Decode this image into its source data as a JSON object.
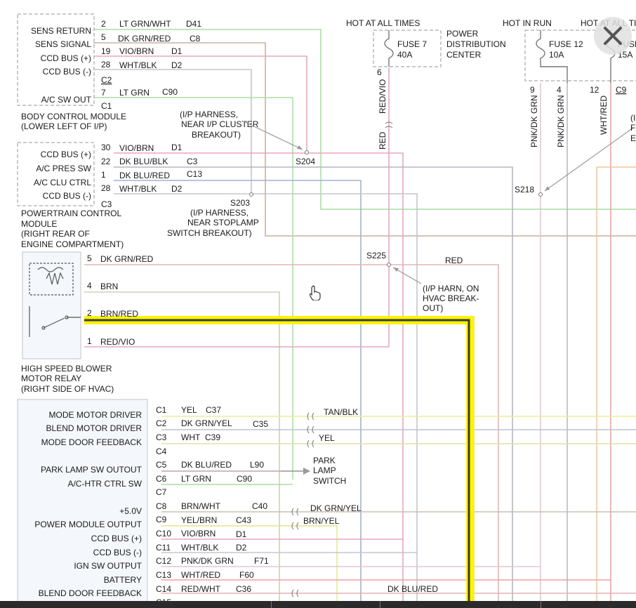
{
  "colors": {
    "highlight": "#fcf400",
    "pink": "#e8a5c4",
    "green": "#a6e0a2",
    "tan": "#c9b29e",
    "gray": "#b5b5c5",
    "blue": "#a3afd8",
    "pinkred": "#f0a0a0",
    "yellow": "#e3e48c"
  },
  "ui": {
    "close_icon": "close-icon",
    "cursor_icon": "hand-pointer-icon"
  },
  "bcm": {
    "pins": [
      {
        "label": "SENS RETURN",
        "num": "2",
        "wire": "LT GRN/WHT",
        "circuit": "D41"
      },
      {
        "label": "SENS SIGNAL",
        "num": "5",
        "wire": "DK GRN/RED",
        "circuit": "C8"
      },
      {
        "label": "CCD BUS (+)",
        "num": "19",
        "wire": "VIO/BRN",
        "circuit": "D1"
      },
      {
        "label": "CCD BUS (-)",
        "num": "28",
        "wire": "WHT/BLK",
        "circuit": "D2"
      },
      {
        "label": "A/C SW OUT",
        "num": "7",
        "wire": "LT GRN",
        "circuit": "C90"
      }
    ],
    "connector1": "C2",
    "connector2": "C1",
    "name1": "BODY CONTROL MODULE",
    "name2": "(LOWER LEFT OF I/P)"
  },
  "pcm": {
    "pins": [
      {
        "label": "CCD BUS (+)",
        "num": "30",
        "wire": "VIO/BRN",
        "circuit": "D1"
      },
      {
        "label": "A/C PRES SW",
        "num": "22",
        "wire": "DK BLU/BLK",
        "circuit": "C3"
      },
      {
        "label": "A/C CLU CTRL",
        "num": "1",
        "wire": "DK BLU/RED",
        "circuit": "C13"
      },
      {
        "label": "CCD BUS (-)",
        "num": "28",
        "wire": "WHT/BLK",
        "circuit": "D2"
      }
    ],
    "connector": "C3",
    "name1": "POWERTRAIN CONTROL",
    "name2": "MODULE",
    "name3": "(RIGHT REAR OF",
    "name4": "ENGINE COMPARTMENT)"
  },
  "splices": {
    "s204": "S204",
    "s204_note1": "(I/P HARNESS,",
    "s204_note2": "NEAR I/P CLUSTER",
    "s204_note3": "BREAKOUT)",
    "s203": "S203",
    "s203_note1": "(I/P HARNESS,",
    "s203_note2": "NEAR STOPLAMP",
    "s203_note3": "SWITCH BREAKOUT)",
    "s225": "S225",
    "s225_note1": "(I/P HARN, ON",
    "s225_note2": "HVAC BREAK-",
    "s225_note3": "OUT)",
    "s218": "S218"
  },
  "fuses": {
    "hot_all_times_1": "HOT AT ALL TIMES",
    "hot_in_run": "HOT IN RUN",
    "hot_all_times_2": "HOT AT ALL TI",
    "fuse7": "FUSE 7",
    "fuse7_amp": "40A",
    "pdc1": "POWER",
    "pdc2": "DISTRIBUTION",
    "pdc3": "CENTER",
    "fuse12": "FUSE 12",
    "fuse12_amp": "10A",
    "fuse_partial": "FUSE",
    "fuse_partial_amp": "15A",
    "pin6": "6",
    "wire_red_vio": "RED/VIO",
    "wire_red": "RED",
    "pin9": "9",
    "pin4": "4",
    "pin12": "12",
    "conn_c9": "C9",
    "wire_pnk_dkgrn_1": "PNK/DK GRN",
    "wire_pnk_dkgrn_2": "PNK/DK GRN",
    "wire_wht_red": "WHT/RED",
    "edge_note1": "(I",
    "edge_note2": "F",
    "edge_note3": "E"
  },
  "relay": {
    "pins": [
      {
        "num": "5",
        "wire": "DK GRN/RED"
      },
      {
        "num": "4",
        "wire": "BRN"
      },
      {
        "num": "2",
        "wire": "BRN/RED"
      },
      {
        "num": "1",
        "wire": "RED/VIO"
      }
    ],
    "red_label": "RED",
    "name1": "HIGH SPEED BLOWER",
    "name2": "MOTOR RELAY",
    "name3": "(RIGHT SIDE OF HVAC)"
  },
  "hvac": {
    "pins": [
      {
        "label": "MODE MOTOR DRIVER",
        "conn": "C1",
        "wire": "YEL",
        "circuit": "C37"
      },
      {
        "label": "BLEND MOTOR DRIVER",
        "conn": "C2",
        "wire": "DK GRN/YEL",
        "circuit": "C35"
      },
      {
        "label": "MODE DOOR FEEDBACK",
        "conn": "C3",
        "wire": "WHT",
        "circuit": "C39"
      },
      {
        "label": "",
        "conn": "C4",
        "wire": "",
        "circuit": ""
      },
      {
        "label": "PARK LAMP SW OUTOUT",
        "conn": "C5",
        "wire": "DK BLU/RED",
        "circuit": "L90"
      },
      {
        "label": "A/C-HTR CTRL SW",
        "conn": "C6",
        "wire": "LT GRN",
        "circuit": "C90"
      },
      {
        "label": "",
        "conn": "C7",
        "wire": "",
        "circuit": ""
      },
      {
        "label": "+5.0V",
        "conn": "C8",
        "wire": "BRN/WHT",
        "circuit": "C40"
      },
      {
        "label": "POWER MODULE OUTPUT",
        "conn": "C9",
        "wire": "YEL/BRN",
        "circuit": "C43"
      },
      {
        "label": "CCD BUS (+)",
        "conn": "C10",
        "wire": "VIO/BRN",
        "circuit": "D1"
      },
      {
        "label": "CCD BUS (-)",
        "conn": "C11",
        "wire": "WHT/BLK",
        "circuit": "D2"
      },
      {
        "label": "IGN SW OUTPUT",
        "conn": "C12",
        "wire": "PNK/DK GRN",
        "circuit": "F71"
      },
      {
        "label": "BATTERY",
        "conn": "C13",
        "wire": "WHT/RED",
        "circuit": "F60"
      },
      {
        "label": "BLEND DOOR FEEDBACK",
        "conn": "C14",
        "wire": "RED/WHT",
        "circuit": "C36"
      }
    ],
    "partial_conn": "C15",
    "tan_blk": "TAN/BLK",
    "yel": "YEL",
    "park1": "PARK",
    "park2": "LAMP",
    "park3": "SWITCH",
    "dk_grn_yel": "DK GRN/YEL",
    "brn_yel": "BRN/YEL",
    "dk_blu_red": "DK BLU/RED"
  }
}
